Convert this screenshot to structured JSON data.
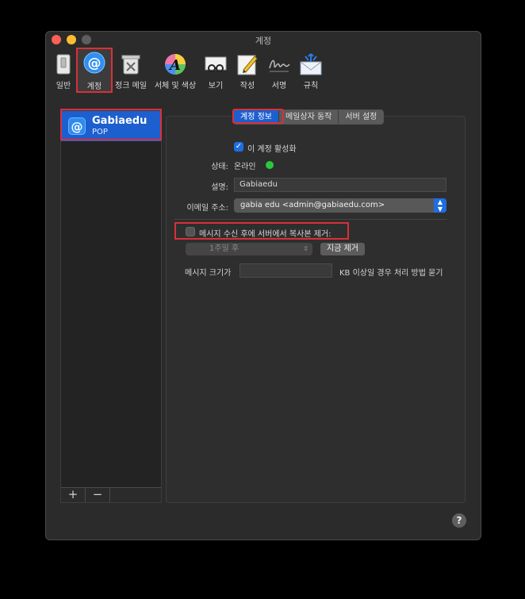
{
  "window": {
    "title": "계정"
  },
  "toolbar": {
    "items": [
      {
        "label": "일반",
        "icon": "general-switch-icon"
      },
      {
        "label": "계정",
        "icon": "at-sign-icon"
      },
      {
        "label": "정크 메일",
        "icon": "junk-trash-icon"
      },
      {
        "label": "서체 및 색상",
        "icon": "font-color-wheel-icon"
      },
      {
        "label": "보기",
        "icon": "glasses-icon"
      },
      {
        "label": "작성",
        "icon": "pencil-icon"
      },
      {
        "label": "서명",
        "icon": "signature-icon"
      },
      {
        "label": "규칙",
        "icon": "envelope-rules-icon"
      }
    ],
    "selected": "계정"
  },
  "accounts": {
    "items": [
      {
        "name": "Gabiaedu",
        "type": "POP"
      }
    ],
    "add_label": "+",
    "remove_label": "−"
  },
  "tabs": {
    "items": [
      "계정 정보",
      "메일상자 동작",
      "서버 설정"
    ],
    "active": "계정 정보"
  },
  "form": {
    "enable_label": "이 계정 활성화",
    "enable_checked": true,
    "status_label": "상태:",
    "status_value": "온라인",
    "description_label": "설명:",
    "description_value": "Gabiaedu",
    "email_label": "이메일 주소:",
    "email_value": "gabia edu <admin@gabiaedu.com>",
    "remove_copy_label": "메시지 수신 후에 서버에서 복사본 제거:",
    "remove_copy_checked": false,
    "remove_after_value": "1주일 후",
    "remove_now_label": "지금 제거",
    "size_label": "메시지 크기가",
    "size_value": "",
    "size_suffix": "KB 이상일 경우 처리 방법 묻기"
  },
  "help_label": "?",
  "colors": {
    "accent": "#1d5fce",
    "highlight": "#d9303a",
    "online": "#29c93e"
  }
}
